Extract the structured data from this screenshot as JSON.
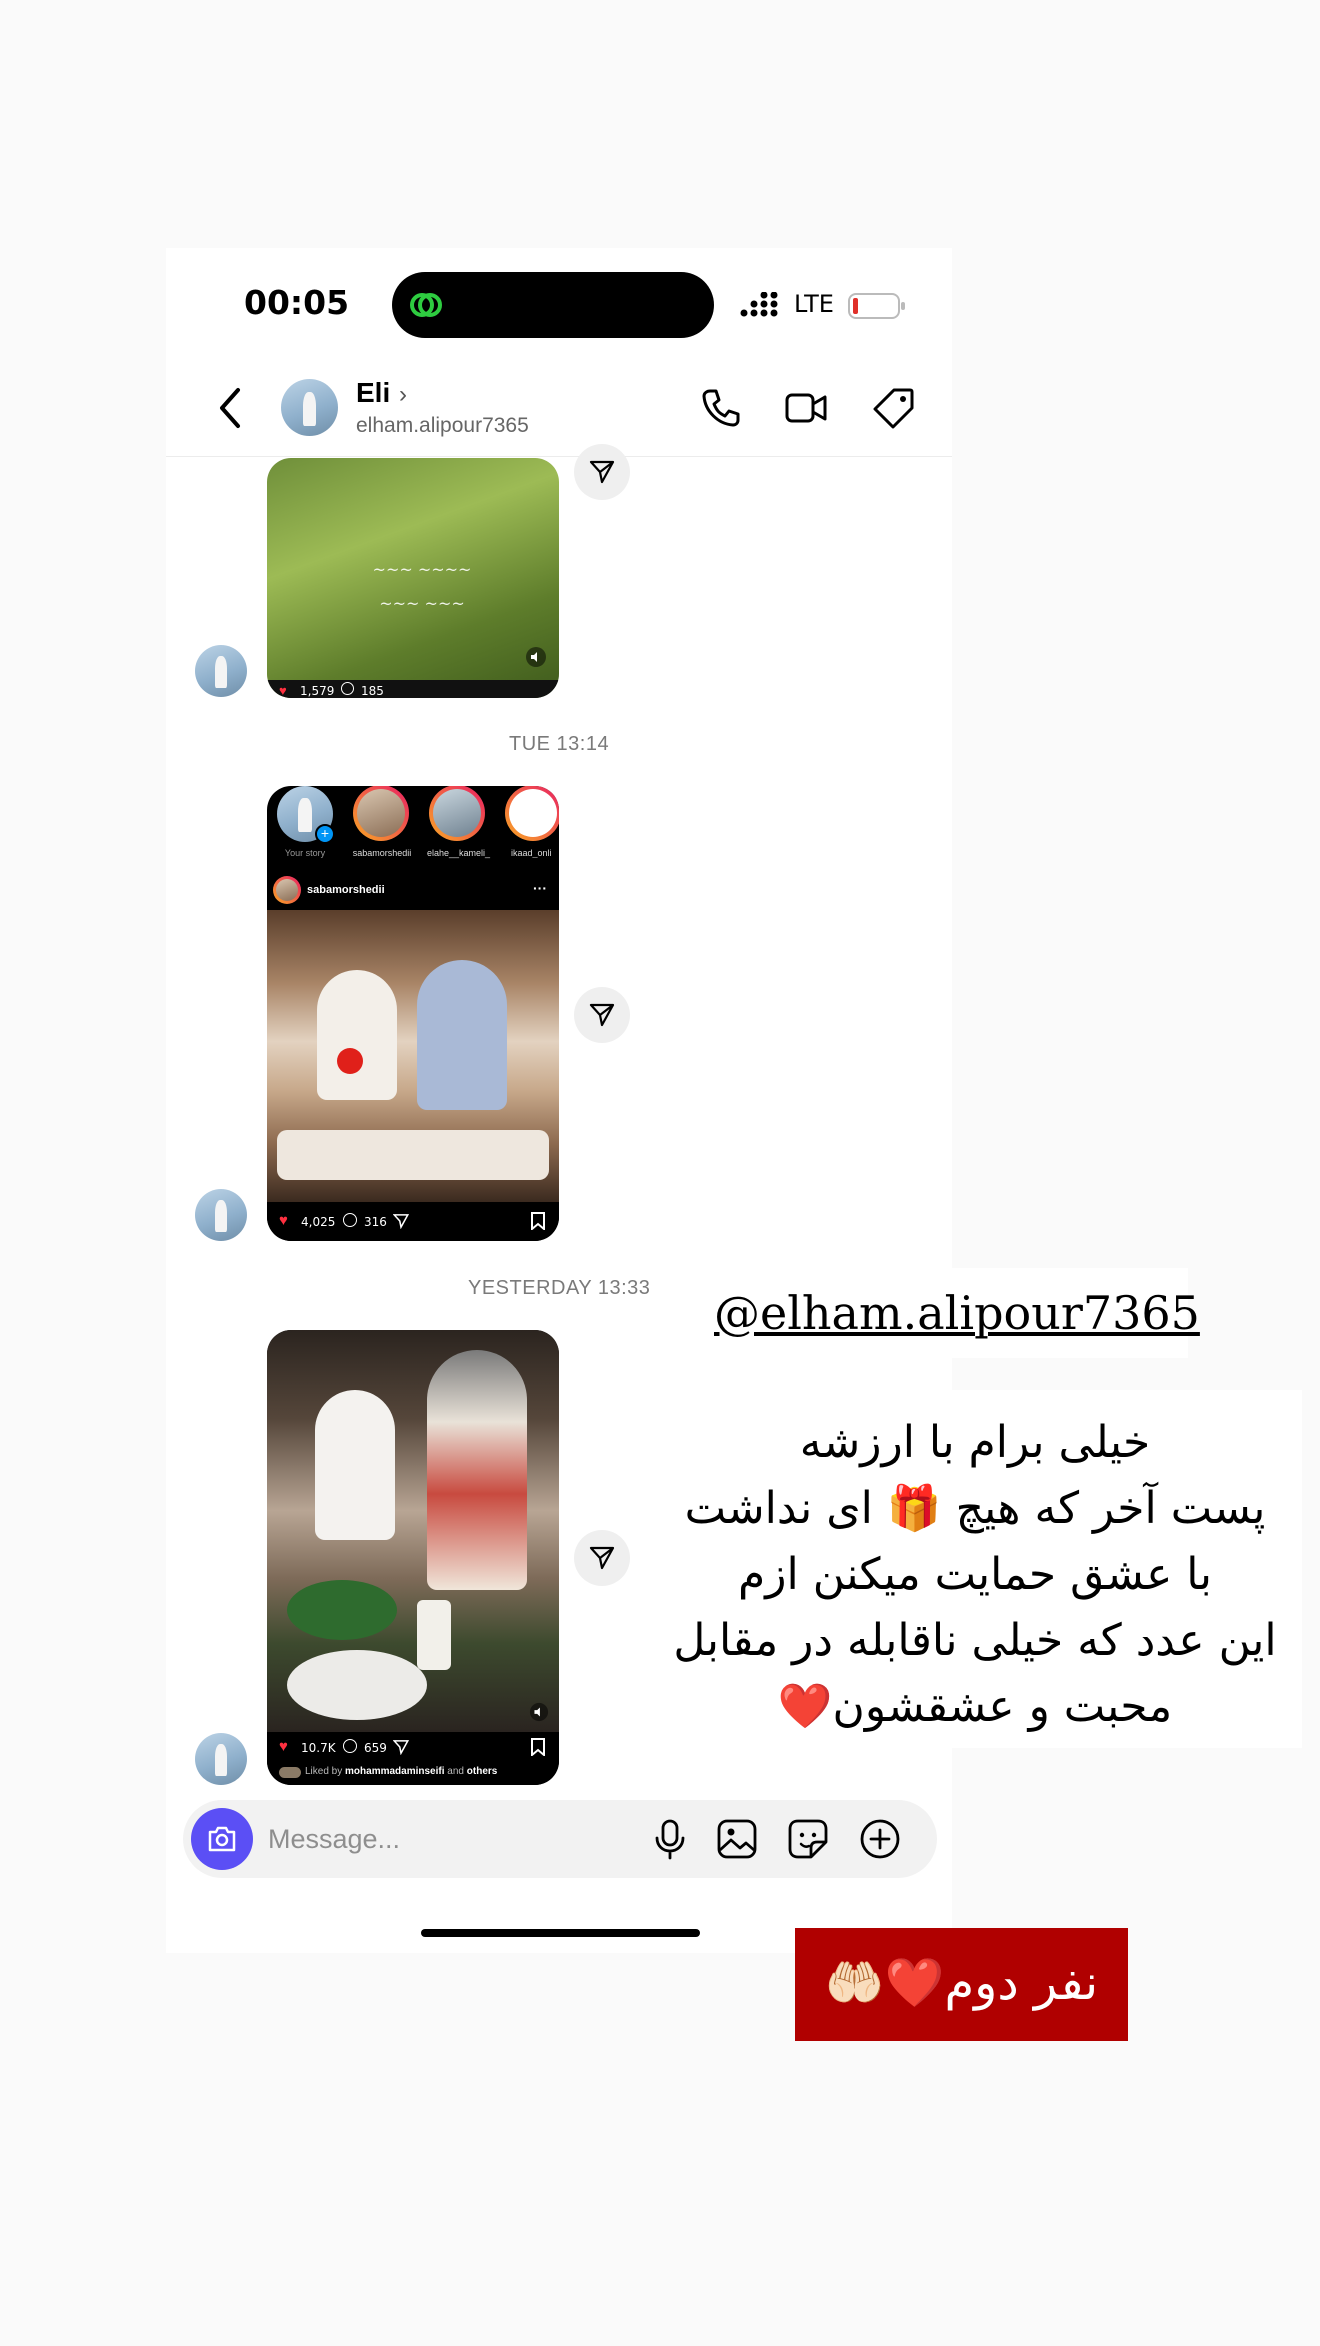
{
  "status_bar": {
    "time": "00:05",
    "network": "LTE"
  },
  "header": {
    "name": "Eli",
    "username": "elham.alipour7365"
  },
  "messages": [
    {
      "post_stats": {
        "likes": "1,579",
        "comments": "185"
      }
    },
    {
      "timestamp": "TUE 13:14",
      "stories": [
        "Your story",
        "sabamorshedii",
        "elahe__kameli_",
        "ikaad_onli"
      ],
      "post_author": "sabamorshedii",
      "post_stats": {
        "likes": "4,025",
        "comments": "316"
      }
    },
    {
      "timestamp": "YESTERDAY 13:33",
      "post_stats": {
        "likes": "10.7K",
        "comments": "659"
      },
      "liked_by_prefix": "Liked by",
      "liked_by_user": "mohammadaminseifi",
      "liked_by_and": "and",
      "liked_by_others": "others"
    }
  ],
  "composer": {
    "placeholder": "Message..."
  },
  "overlay": {
    "mention": "@elham.alipour7365",
    "message_lines": [
      "خیلی برام با ارزشه",
      "پست آخر که هیچ 🎁 ای نداشت",
      "با عشق حمایت میکنن ازم",
      "این عدد که خیلی ناقابله در مقابل",
      "محبت و عشقشون❤️"
    ],
    "badge": "نفر دوم❤️🤲🏻"
  },
  "colors": {
    "accent": "#5b4ff5",
    "like": "#ff3040",
    "badge_bg": "#b00000"
  }
}
